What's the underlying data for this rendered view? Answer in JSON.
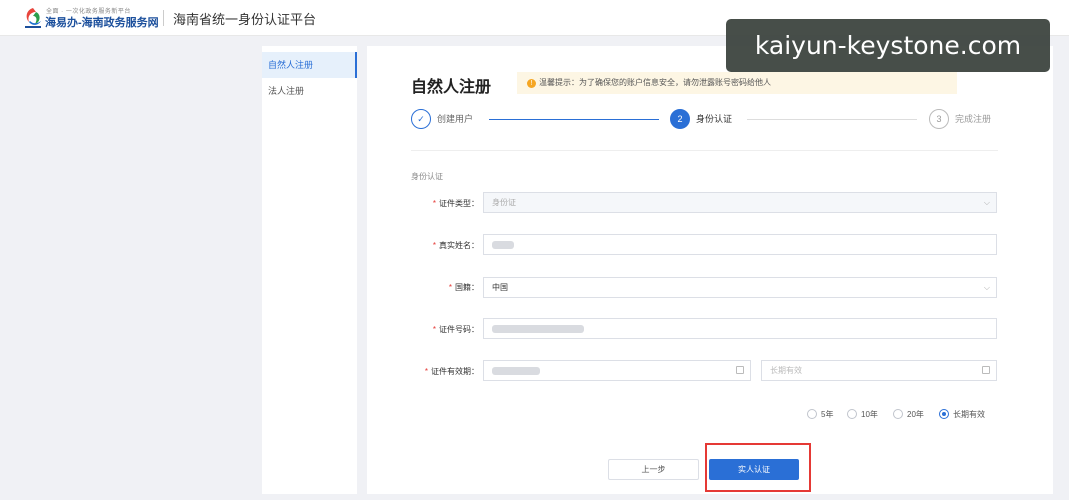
{
  "header": {
    "logo_small": "全面 · 一次化政务服务新平台",
    "logo_main": "海易办-海南政务服务网",
    "site_title": "海南省统一身份认证平台"
  },
  "watermark": "kaiyun-keystone.com",
  "sidebar": {
    "items": [
      {
        "label": "自然人注册",
        "active": true
      },
      {
        "label": "法人注册",
        "active": false
      }
    ]
  },
  "main": {
    "title": "自然人注册",
    "tip": "温馨提示：为了确保您的账户信息安全，请勿泄露账号密码给他人",
    "steps": [
      {
        "number": "✓",
        "label": "创建用户"
      },
      {
        "number": "2",
        "label": "身份认证"
      },
      {
        "number": "3",
        "label": "完成注册"
      }
    ],
    "section_label": "身份认证",
    "form": {
      "id_type": {
        "label": "证件类型：",
        "value": "身份证"
      },
      "real_name": {
        "label": "真实姓名："
      },
      "nationality": {
        "label": "国籍：",
        "value": "中国"
      },
      "id_number": {
        "label": "证件号码："
      },
      "validity": {
        "label": "证件有效期：",
        "end_placeholder": "长期有效"
      }
    },
    "validity_options": [
      {
        "label": "5年",
        "checked": false
      },
      {
        "label": "10年",
        "checked": false
      },
      {
        "label": "20年",
        "checked": false
      },
      {
        "label": "长期有效",
        "checked": true
      }
    ],
    "buttons": {
      "prev": "上一步",
      "next": "实人认证"
    }
  },
  "colors": {
    "primary": "#2a6fd6",
    "required": "#e53935",
    "highlight": "#e53935"
  }
}
